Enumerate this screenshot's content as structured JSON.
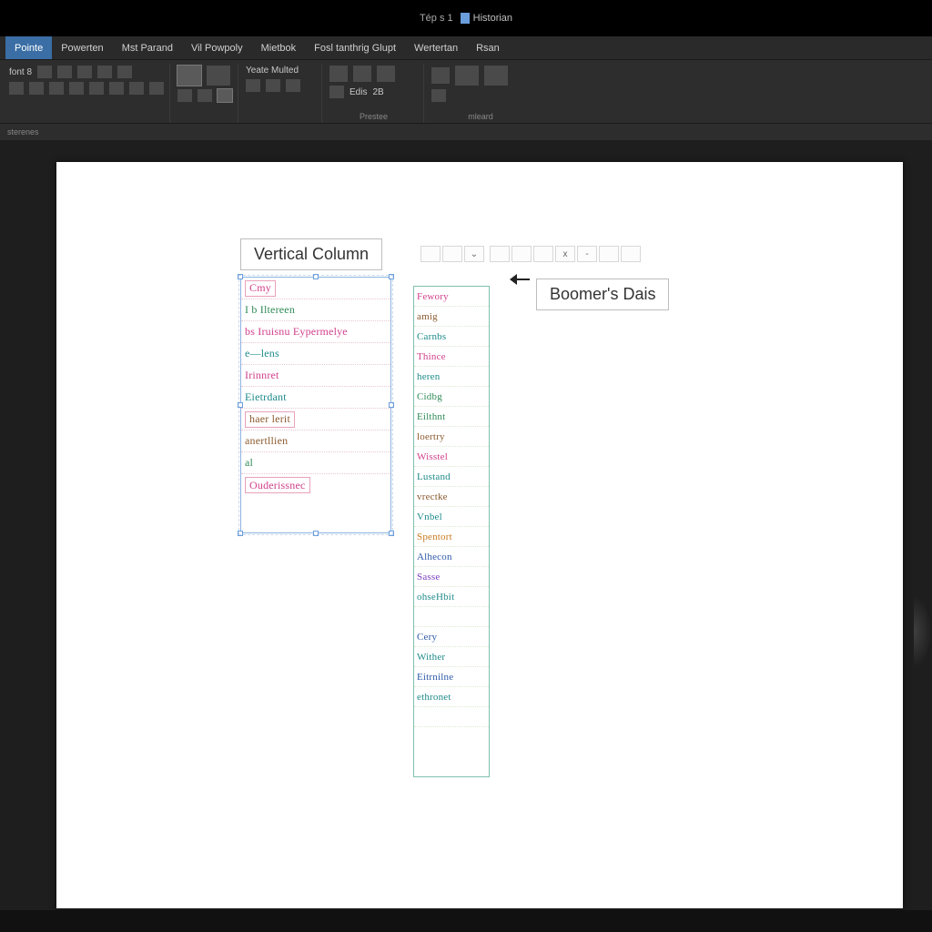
{
  "titlebar": {
    "page_label": "Tép s 1",
    "doc_label": "Historian"
  },
  "ribbon": {
    "tabs": [
      "Pointe",
      "Powerten",
      "Mst Parand",
      "Vil Powpoly",
      "Mietbok",
      "Fosl tanthrig Glupt",
      "Wertertan",
      "Rsan"
    ],
    "active_tab": 0,
    "groups": [
      {
        "label": "",
        "note": "font 8"
      },
      {
        "label": "Yeate Multed"
      },
      {
        "label": "2B"
      },
      {
        "label": "Prestee"
      },
      {
        "label": "mleard"
      }
    ]
  },
  "qat": {
    "text": "sterenes"
  },
  "page": {
    "label_vertical_column": "Vertical Column",
    "label_boomer_data": "Boomer's Dais",
    "mini_toolbar": [
      "",
      "",
      "⌄",
      "",
      "",
      "",
      "x",
      "-",
      "",
      ""
    ]
  },
  "left_column_rows": [
    {
      "text": "Cmy",
      "cls": "c-pink",
      "boxed": true
    },
    {
      "text": "I b  Iltereen",
      "cls": "c-green"
    },
    {
      "text": "bs Iruisnu  Eypermelye",
      "cls": "c-pink"
    },
    {
      "text": "e—lens",
      "cls": "c-teal"
    },
    {
      "text": "Irinnret",
      "cls": "c-pink"
    },
    {
      "text": "Eietrdant",
      "cls": "c-teal"
    },
    {
      "text": "haer lerit",
      "cls": "c-brown",
      "boxed": true
    },
    {
      "text": "anertllien",
      "cls": "c-brown"
    },
    {
      "text": "al",
      "cls": "c-green"
    },
    {
      "text": "Ouderissnec",
      "cls": "c-pink",
      "boxed": true
    }
  ],
  "right_column_rows": [
    {
      "text": "Fewory",
      "cls": "c-pink"
    },
    {
      "text": "amig",
      "cls": "c-brown"
    },
    {
      "text": "Carnbs",
      "cls": "c-teal"
    },
    {
      "text": "Thince",
      "cls": "c-pink"
    },
    {
      "text": "heren",
      "cls": "c-teal"
    },
    {
      "text": "Cidbg",
      "cls": "c-green"
    },
    {
      "text": "Eilthnt",
      "cls": "c-green"
    },
    {
      "text": "loertry",
      "cls": "c-brown"
    },
    {
      "text": "Wisstel",
      "cls": "c-pink"
    },
    {
      "text": "Lustand",
      "cls": "c-teal"
    },
    {
      "text": "vrectke",
      "cls": "c-brown"
    },
    {
      "text": "Vnbel",
      "cls": "c-teal"
    },
    {
      "text": "Spentort",
      "cls": "c-orange"
    },
    {
      "text": "Alhecon",
      "cls": "c-blue"
    },
    {
      "text": "Sasse",
      "cls": "c-purple"
    },
    {
      "text": "ohseHbit",
      "cls": "c-teal"
    },
    {
      "text": "",
      "cls": ""
    },
    {
      "text": "Cery",
      "cls": "c-blue"
    },
    {
      "text": "Wither",
      "cls": "c-teal"
    },
    {
      "text": "Eitrnilne",
      "cls": "c-blue"
    },
    {
      "text": "ethronet",
      "cls": "c-teal"
    },
    {
      "text": "",
      "cls": ""
    },
    {
      "text": "",
      "cls": ""
    }
  ]
}
